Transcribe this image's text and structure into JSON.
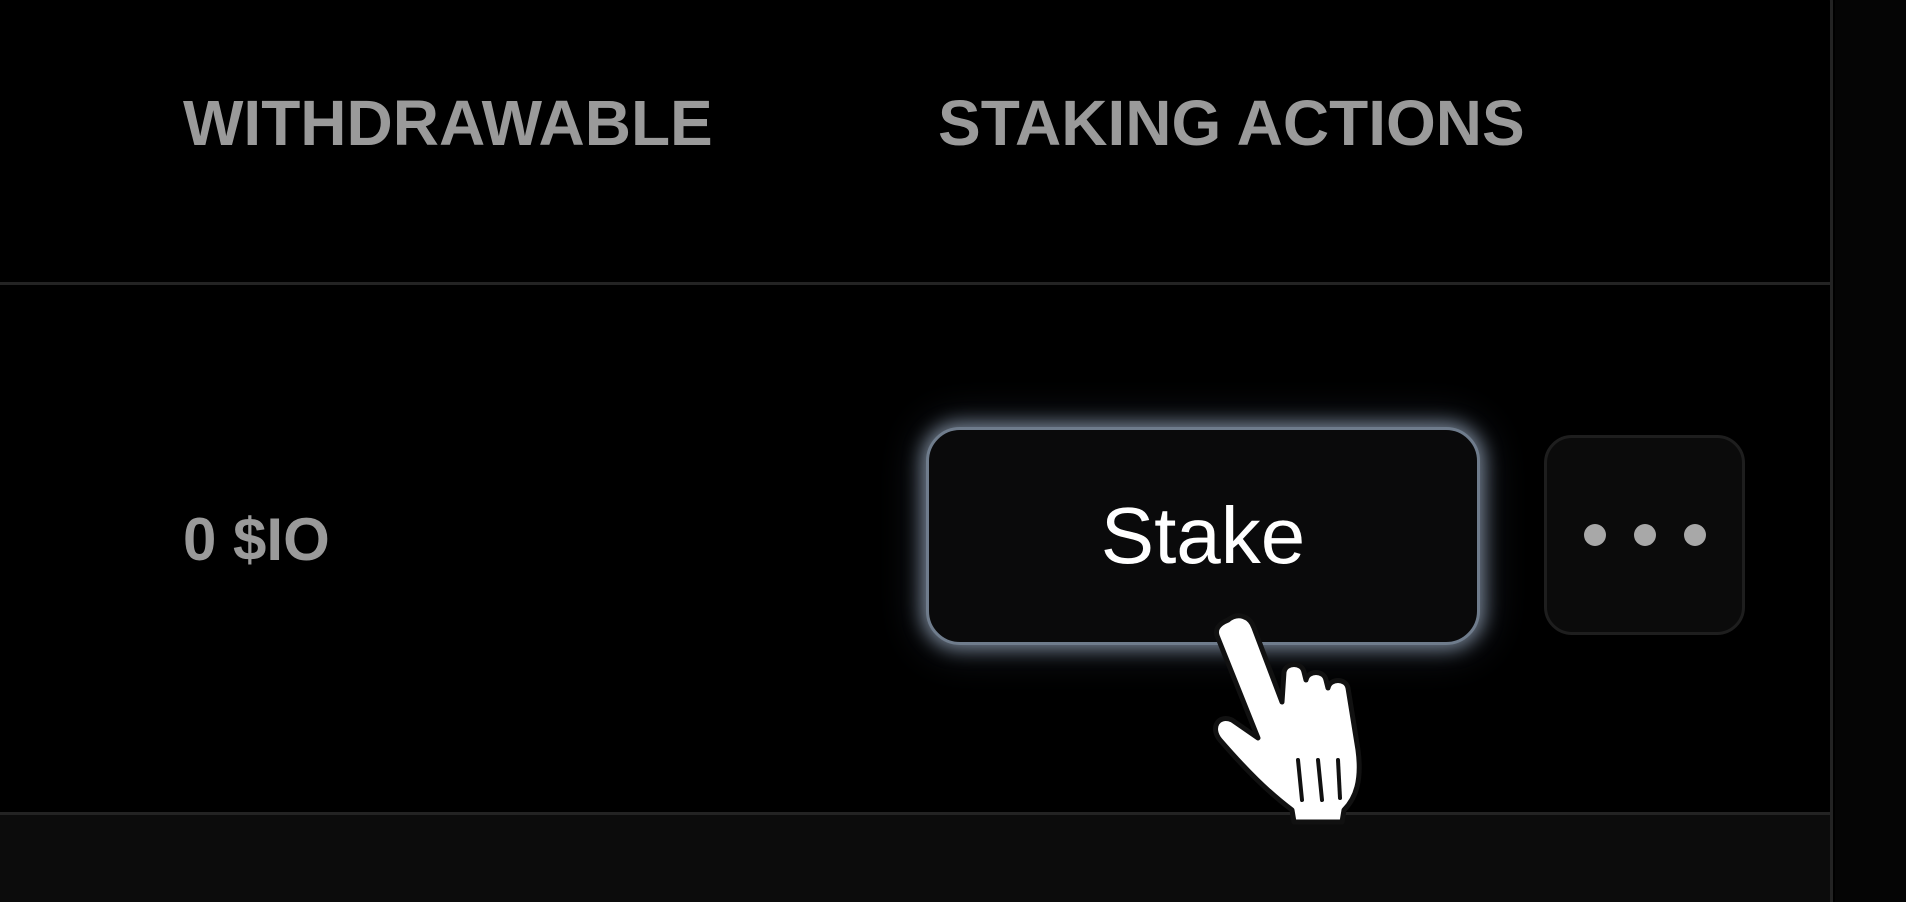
{
  "table": {
    "headers": {
      "withdrawable": "WITHDRAWABLE",
      "staking_actions": "STAKING ACTIONS"
    },
    "rows": [
      {
        "withdrawable": "0 $IO",
        "stake_label": "Stake",
        "more_icon": "ellipsis-icon"
      }
    ]
  },
  "cursor": {
    "icon": "hand-pointer-icon"
  }
}
